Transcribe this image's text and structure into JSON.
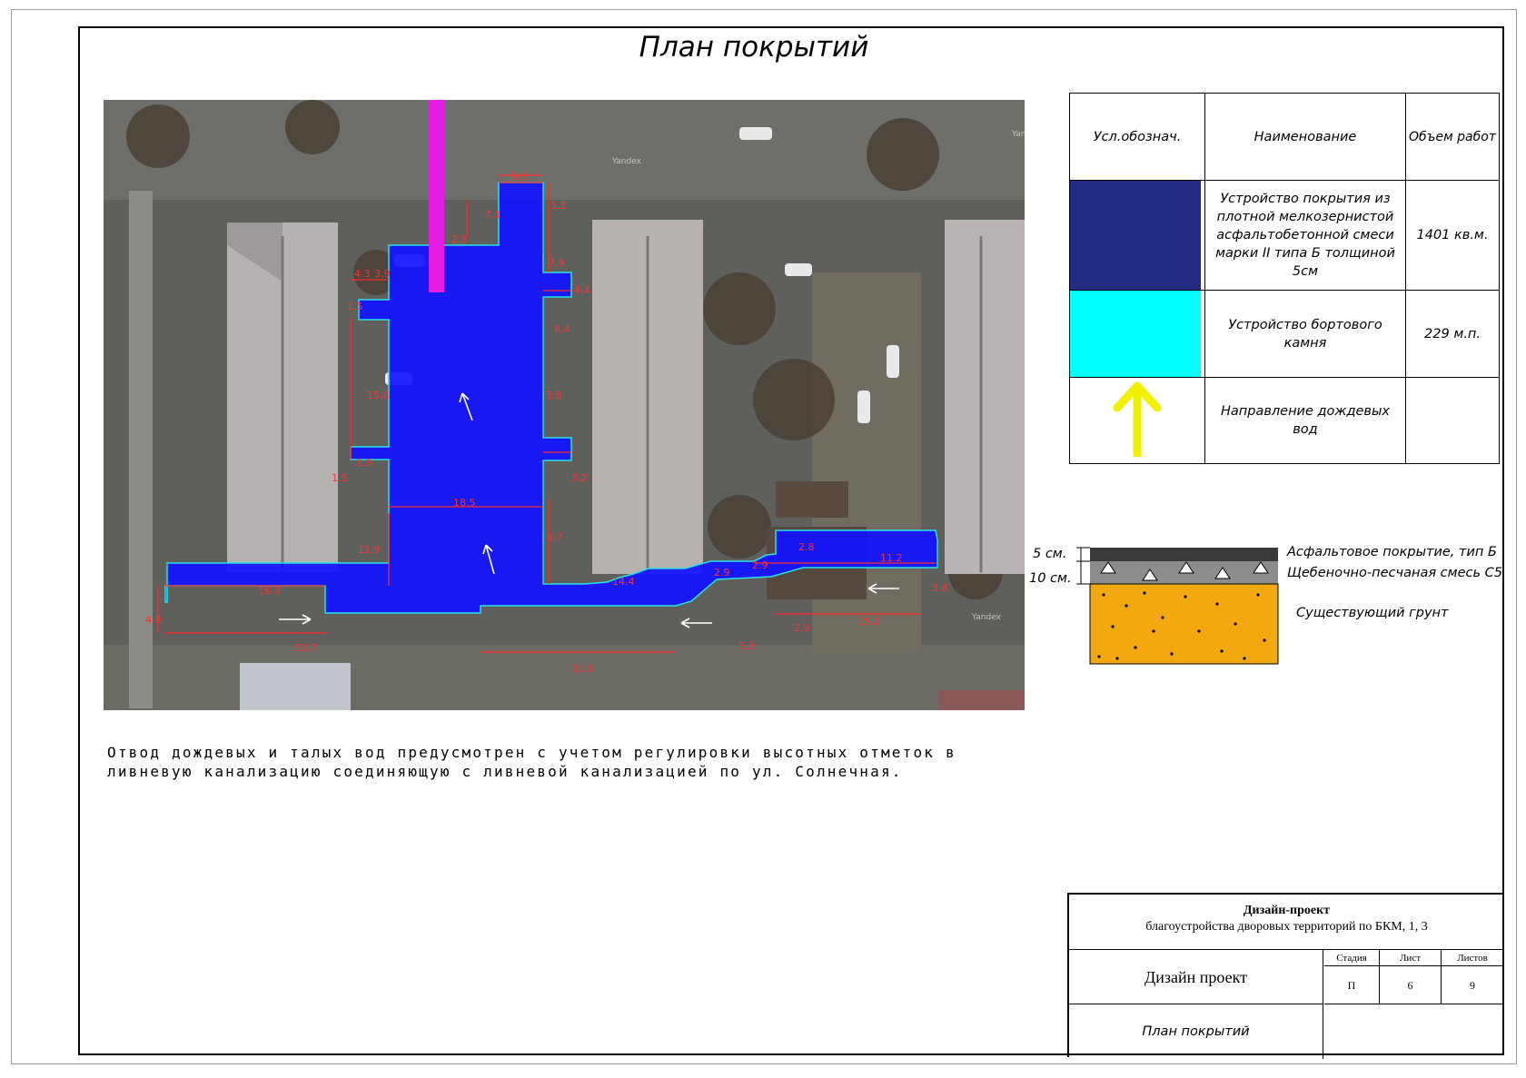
{
  "title": "План покрытий",
  "photo": {
    "dimensions": [
      "5.6",
      "5.1",
      "7.1",
      "2.8",
      "7.9",
      "4.3",
      "4.4",
      "1.5",
      "3.9",
      "8.4",
      "15.8",
      "3.8",
      "2.9",
      "1.5",
      "3.2",
      "18.5",
      "3.7",
      "11.9",
      "16.3",
      "4.9",
      "33.7",
      "14.4",
      "31.8",
      "2.9",
      "2.9",
      "2.8",
      "11.2",
      "3.8",
      "15.2",
      "5.9",
      "2.9"
    ],
    "watermarks": [
      "Yandex",
      "Yandex",
      "Yande"
    ]
  },
  "legend": {
    "headers": [
      "Усл.обознач.",
      "Наименование",
      "Объем работ"
    ],
    "rows": [
      {
        "swatch_color": "#242d85",
        "name": "Устройство покрытия из плотной мелкозернистой асфальтобетонной смеси марки II типа Б толщиной 5см",
        "volume": "1401 кв.м."
      },
      {
        "swatch_color": "#00ffff",
        "name": "Устройство бортового камня",
        "volume": "229 м.п."
      },
      {
        "symbol": "yellow-arrow",
        "symbol_color": "#f0f000",
        "name": "Направление дождевых вод",
        "volume": ""
      }
    ]
  },
  "section": {
    "thickness_labels": [
      "5 см.",
      "10 см."
    ],
    "layers": [
      "Асфальтовое покрытие, тип Б",
      "Щебеночно-песчаная смесь С5",
      "Существующий грунт"
    ],
    "colors": {
      "asphalt": "#3a3a3a",
      "gravel": "#8c8c8c",
      "soil": "#f1a90f"
    }
  },
  "note": [
    "Отвод дождевых и талых вод предусмотрен с учетом регулировки высотных отметок в",
    "ливневую канализацию соединяющую с ливневой канализацией по ул. Солнечная."
  ],
  "stamp": {
    "title_bold": "Дизайн-проект",
    "title_sub": "благоустройства дворовых территорий по БКМ, 1, 3",
    "left_top": "Дизайн проект",
    "left_bottom": "План покрытий",
    "headers": [
      "Стадия",
      "Лист",
      "Листов"
    ],
    "values": [
      "П",
      "6",
      "9"
    ]
  }
}
